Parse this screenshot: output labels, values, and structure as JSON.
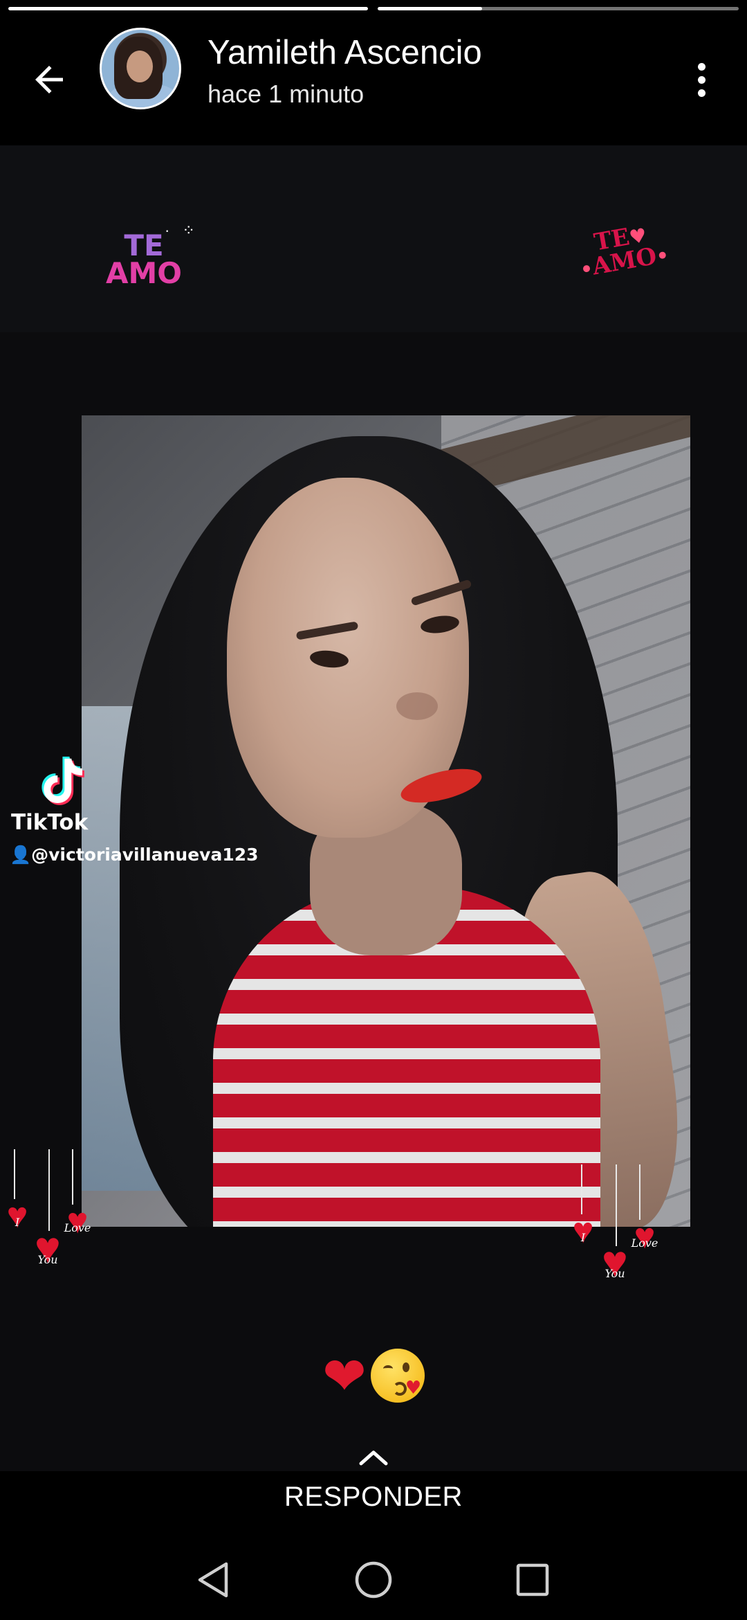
{
  "story": {
    "progress": [
      {
        "label": "segment-1",
        "fill": 1.0
      },
      {
        "label": "segment-2",
        "fill": 0.29
      }
    ]
  },
  "header": {
    "user_name": "Yamileth Ascencio",
    "timestamp": "hace 1 minuto",
    "back_icon": "arrow-left-icon",
    "more_icon": "more-vertical-icon"
  },
  "stickers": {
    "teamo_left_line1": "TE",
    "teamo_left_line2": "AMO",
    "teamo_right_line1": "TE",
    "teamo_right_line2": "AMO"
  },
  "watermark": {
    "brand": "TikTok",
    "handle": "@victoriavillanueva123"
  },
  "hearts": {
    "i": "I",
    "love": "Love",
    "you": "You"
  },
  "caption": {
    "emoji": "❤️😘"
  },
  "reply": {
    "label": "RESPONDER",
    "icon": "chevron-up-icon"
  },
  "nav": {
    "back": "nav-back-icon",
    "home": "nav-home-icon",
    "recents": "nav-recents-icon"
  },
  "colors": {
    "background": "#000000",
    "story_bg": "#0c0c0e",
    "progress_track": "#737373",
    "progress_fill": "#ffffff",
    "heart_red": "#e0152e"
  }
}
